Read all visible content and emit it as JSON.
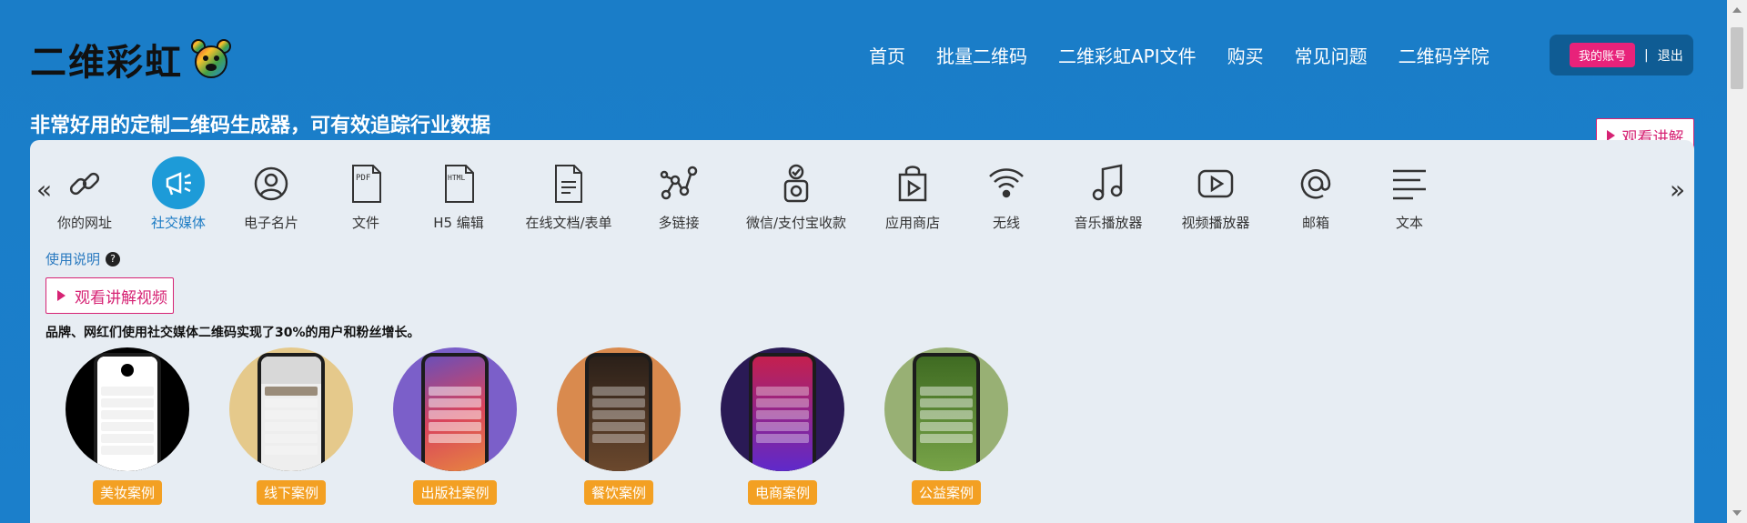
{
  "header": {
    "logo_text": "二维彩虹",
    "nav": [
      "首页",
      "批量二维码",
      "二维彩虹API文件",
      "购买",
      "常见问题",
      "二维码学院"
    ],
    "account_button": "我的账号",
    "separator": "|",
    "logout": "退出"
  },
  "tagline": "非常好用的定制二维码生成器，可有效追踪行业数据",
  "watch_top": "观看讲解",
  "categories": [
    {
      "label": "你的网址",
      "icon": "link-icon"
    },
    {
      "label": "社交媒体",
      "icon": "megaphone-icon"
    },
    {
      "label": "电子名片",
      "icon": "user-icon"
    },
    {
      "label": "文件",
      "icon": "pdf-icon",
      "badge": "PDF"
    },
    {
      "label": "H5 编辑",
      "icon": "html-icon",
      "badge": "HTML"
    },
    {
      "label": "在线文档/表单",
      "icon": "document-icon"
    },
    {
      "label": "多链接",
      "icon": "network-icon"
    },
    {
      "label": "微信/支付宝收款",
      "icon": "wallet-icon"
    },
    {
      "label": "应用商店",
      "icon": "shopping-bag-icon"
    },
    {
      "label": "无线",
      "icon": "wifi-icon"
    },
    {
      "label": "音乐播放器",
      "icon": "music-icon"
    },
    {
      "label": "视频播放器",
      "icon": "video-icon"
    },
    {
      "label": "邮箱",
      "icon": "at-icon"
    },
    {
      "label": "文本",
      "icon": "text-icon"
    }
  ],
  "arrows": {
    "left": "«",
    "right": "»"
  },
  "help": {
    "label": "使用说明",
    "icon_text": "?"
  },
  "watch_video": "观看讲解视频",
  "description": "品牌、网红们使用社交媒体二维码实现了30%的用户和粉丝增长。",
  "cases": [
    {
      "label": "美妆案例",
      "bg": "#000000",
      "screen_hdr": "#ffffff"
    },
    {
      "label": "线下案例",
      "bg": "#e5c98b",
      "screen_hdr": "#d8d8d8"
    },
    {
      "label": "出版社案例",
      "bg": "#7b5fc9",
      "screen_hdr": "#c64a7a"
    },
    {
      "label": "餐饮案例",
      "bg": "#d98a4e",
      "screen_hdr": "#3a2a20"
    },
    {
      "label": "电商案例",
      "bg": "#2a1a55",
      "screen_hdr": "#c4204e"
    },
    {
      "label": "公益案例",
      "bg": "#98b074",
      "screen_hdr": "#4b7a2a"
    }
  ],
  "colors": {
    "accent": "#d62374",
    "active": "#1d9bd8",
    "case_label": "#f3a023"
  }
}
